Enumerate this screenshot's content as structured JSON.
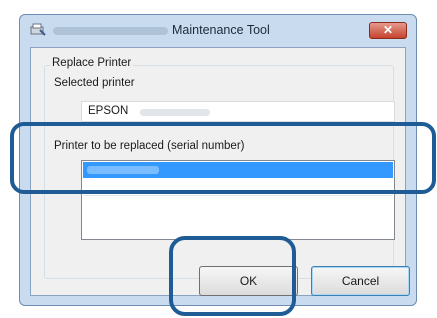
{
  "window": {
    "title": "Maintenance Tool",
    "close_label": "✕"
  },
  "group": {
    "legend": "Replace Printer",
    "selected_printer_label": "Selected printer",
    "selected_printer_value": "EPSON",
    "replace_label": "Printer to be replaced (serial number)"
  },
  "buttons": {
    "ok": "OK",
    "cancel": "Cancel"
  },
  "colors": {
    "highlight": "#1f5b94",
    "selection": "#3399ff",
    "close_button": "#c7422d"
  }
}
